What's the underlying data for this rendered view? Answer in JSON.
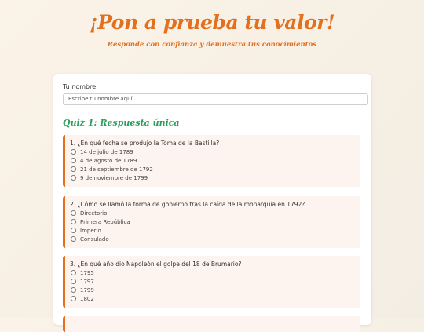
{
  "header": {
    "title": "¡Pon a prueba tu valor!",
    "subtitle": "Responde con confianza y demuestra tus conocimientos"
  },
  "form": {
    "name_label": "Tu nombre:",
    "name_placeholder": "Escribe tu nombre aquí",
    "name_value": ""
  },
  "quiz": {
    "title": "Quiz 1: Respuesta única",
    "questions": [
      {
        "text": "1. ¿En qué fecha se produjo la Toma de la Bastilla?",
        "options": [
          "14 de julio de 1789",
          "4 de agosto de 1789",
          "21 de septiembre de 1792",
          "9 de noviembre de 1799"
        ]
      },
      {
        "text": "2. ¿Cómo se llamó la forma de gobierno tras la caída de la monarquía en 1792?",
        "options": [
          "Directorio",
          "Primera República",
          "Imperio",
          "Consulado"
        ]
      },
      {
        "text": "3. ¿En qué año dio Napoleón el golpe del 18 de Brumario?",
        "options": [
          "1795",
          "1797",
          "1799",
          "1802"
        ]
      }
    ]
  },
  "colors": {
    "accent": "#e2701f",
    "quiz_title": "#2a9d5c",
    "question_bg": "#fdf3ef"
  }
}
